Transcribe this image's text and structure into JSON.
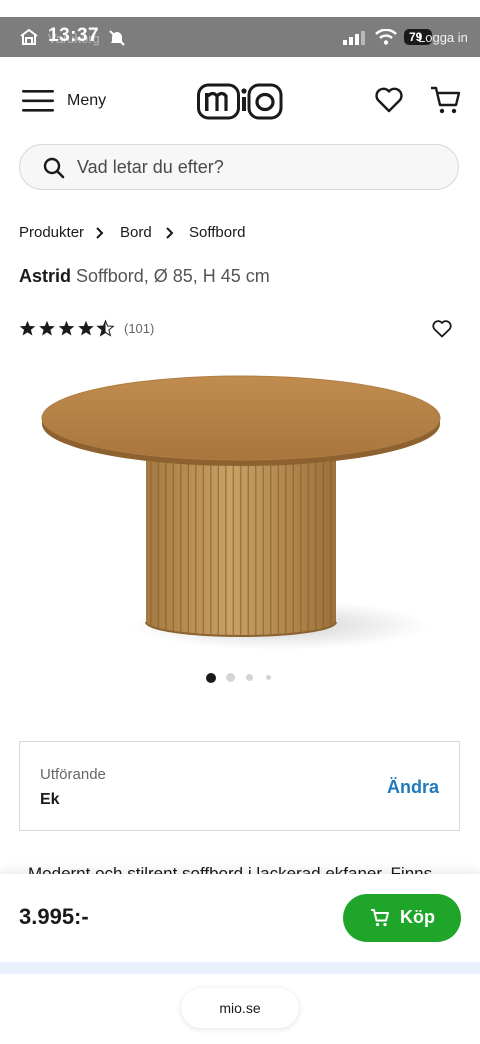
{
  "status_bar": {
    "time": "13:37",
    "battery": "79",
    "ghost_left": "Varukorg",
    "ghost_right": "Logga in"
  },
  "header": {
    "menu_label": "Meny",
    "brand": "mio"
  },
  "search": {
    "placeholder": "Vad letar du efter?"
  },
  "breadcrumb": [
    "Produkter",
    "Bord",
    "Soffbord"
  ],
  "product": {
    "name": "Astrid",
    "description_title": "Soffbord, Ø 85, H 45 cm",
    "rating": 4.5,
    "review_count": "(101)",
    "image_count": 4,
    "active_image": 1
  },
  "variant": {
    "label": "Utförande",
    "value": "Ek",
    "change_label": "Ändra"
  },
  "description": "Modernt och stilrent soffbord i lackerad ekfaner. Finns",
  "buy_bar": {
    "price": "3.995:-",
    "buy_label": "Köp"
  },
  "browser": {
    "url": "mio.se"
  },
  "colors": {
    "accent_green": "#1ea52a",
    "link_blue": "#1f7abd",
    "wood": "#b8894a"
  }
}
